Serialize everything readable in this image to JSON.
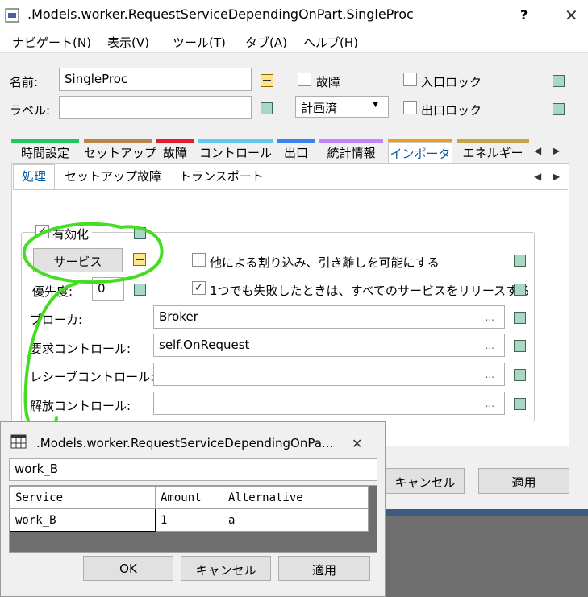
{
  "window": {
    "title": ".Models.worker.RequestServiceDependingOnPart.SingleProc",
    "help": "?",
    "close": "✕"
  },
  "menu": [
    "ナビゲート(N)",
    "表示(V)",
    "ツール(T)",
    "タブ(A)",
    "ヘルプ(H)"
  ],
  "form": {
    "name_label": "名前:",
    "name_value": "SingleProc",
    "label_label": "ラベル:",
    "label_value": "",
    "failure_label": "故障",
    "plan_value": "計画済",
    "entry_lock": "入口ロック",
    "exit_lock": "出口ロック"
  },
  "tabs": [
    {
      "label": "時間設定",
      "color": "#22c55e"
    },
    {
      "label": "セットアップ",
      "color": "#b8864b"
    },
    {
      "label": "故障",
      "color": "#e11d2b"
    },
    {
      "label": "コントロール",
      "color": "#60c8f0"
    },
    {
      "label": "出口",
      "color": "#3b82f6"
    },
    {
      "label": "統計情報",
      "color": "#c084fc"
    },
    {
      "label": "インポータ",
      "color": "#f59e0b"
    },
    {
      "label": "エネルギー",
      "color": "#c8a24b"
    }
  ],
  "subtabs": [
    "処理",
    "セットアップ",
    "故障",
    "トランスポート"
  ],
  "importer": {
    "enable_label": "有効化",
    "service_button": "サービス",
    "priority_label": "優先度:",
    "priority_value": "0",
    "interrupt_label": "他による割り込み、引き離しを可能にする",
    "release_label": "1つでも失敗したときは、すべてのサービスをリリースする",
    "broker_label": "ブローカ:",
    "broker_value": "Broker",
    "request_label": "要求コントロール:",
    "request_value": "self.OnRequest",
    "receive_label": "レシーブコントロール:",
    "receive_value": "",
    "release_ctrl_label": "解放コントロール:",
    "release_ctrl_value": "",
    "ellipsis": "..."
  },
  "main_buttons": {
    "cancel": "キャンセル",
    "apply": "適用"
  },
  "dialog": {
    "title": ".Models.worker.RequestServiceDependingOnPa...",
    "close": "✕",
    "filter_value": "work_B",
    "columns": [
      "Service",
      "Amount",
      "Alternative"
    ],
    "rows": [
      [
        "work_B",
        "1",
        "a"
      ]
    ],
    "ok": "OK",
    "cancel": "キャンセル",
    "apply": "適用"
  },
  "colors": {
    "annotation": "#44dd22",
    "accent_tab": "#f59e0b"
  }
}
